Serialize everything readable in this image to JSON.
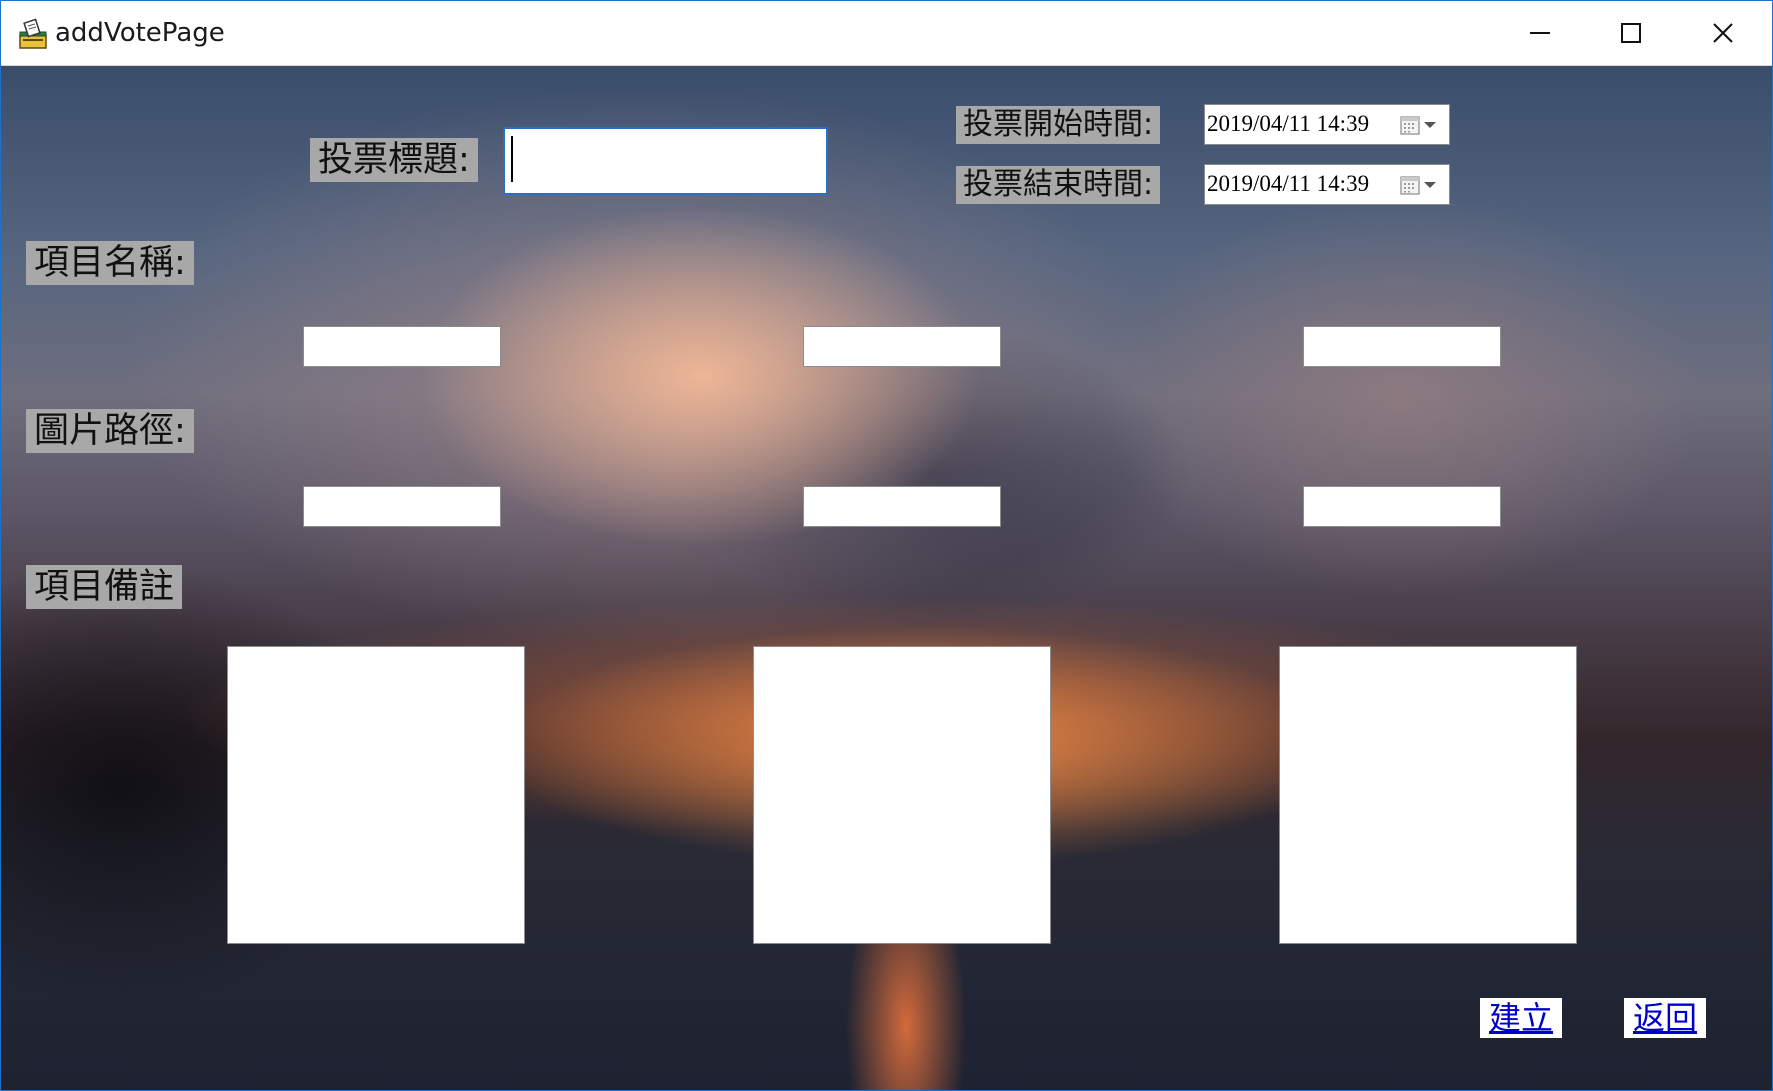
{
  "window": {
    "title": "addVotePage",
    "accent": "#1e73c8"
  },
  "icons": {
    "app": "ballot-box-icon",
    "minimize": "minimize-icon",
    "maximize": "maximize-icon",
    "close": "close-icon",
    "calendar": "calendar-icon",
    "dropdown": "chevron-down-icon"
  },
  "form": {
    "title_label": "投票標題:",
    "title_value": "",
    "start_label": "投票開始時間:",
    "start_value": "2019/04/11 14:39",
    "end_label": "投票結束時間:",
    "end_value": "2019/04/11 14:39",
    "item_name_label": "項目名稱:",
    "image_path_label": "圖片路徑:",
    "item_note_label": "項目備註",
    "item_names": [
      "",
      "",
      ""
    ],
    "image_paths": [
      "",
      "",
      ""
    ],
    "item_notes": [
      "",
      "",
      ""
    ]
  },
  "actions": {
    "create_label": "建立",
    "back_label": "返回",
    "link_color": "#0000cc"
  }
}
